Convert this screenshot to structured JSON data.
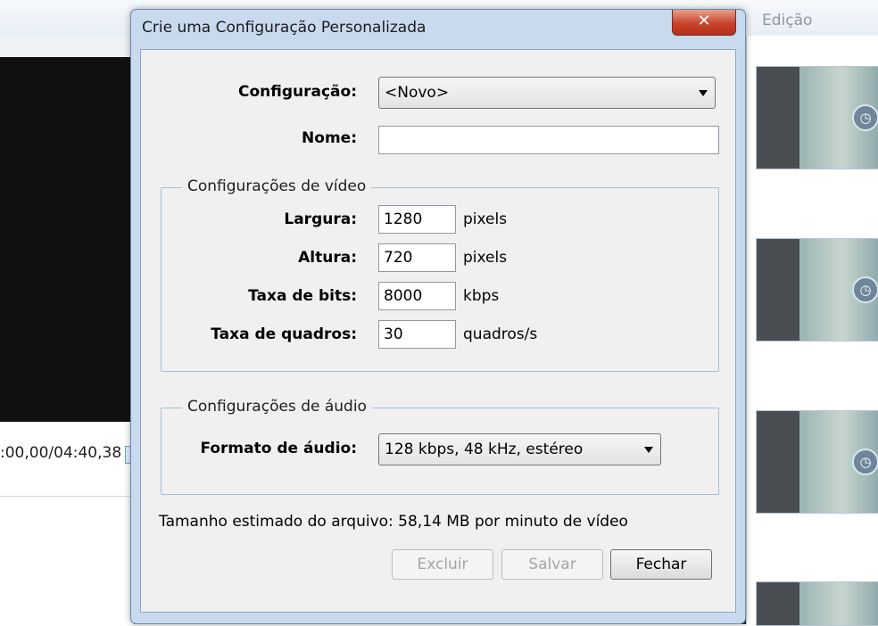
{
  "background": {
    "tab_label": "Edição",
    "time_display": ":00,00/04:40,38"
  },
  "dialog": {
    "title": "Crie uma Configuração Personalizada",
    "close_symbol": "✕",
    "configuracao_label": "Configuração:",
    "configuracao_value": "<Novo>",
    "nome_label": "Nome:",
    "nome_value": "",
    "video_group": {
      "legend": "Configurações de vídeo",
      "largura_label": "Largura:",
      "largura_value": "1280",
      "largura_unit": "pixels",
      "altura_label": "Altura:",
      "altura_value": "720",
      "altura_unit": "pixels",
      "taxa_bits_label": "Taxa de bits:",
      "taxa_bits_value": "8000",
      "taxa_bits_unit": "kbps",
      "taxa_quadros_label": "Taxa de quadros:",
      "taxa_quadros_value": "30",
      "taxa_quadros_unit": "quadros/s"
    },
    "audio_group": {
      "legend": "Configurações de áudio",
      "formato_label": "Formato de áudio:",
      "formato_value": "128 kbps, 48 kHz, estéreo"
    },
    "estimate_text": "Tamanho estimado do arquivo: 58,14 MB por minuto de vídeo",
    "buttons": {
      "excluir": "Excluir",
      "salvar": "Salvar",
      "fechar": "Fechar"
    }
  },
  "colors": {
    "dialog_frame": "#c9daee",
    "close_button": "#c8432b",
    "client_bg": "#f0f0f0"
  }
}
